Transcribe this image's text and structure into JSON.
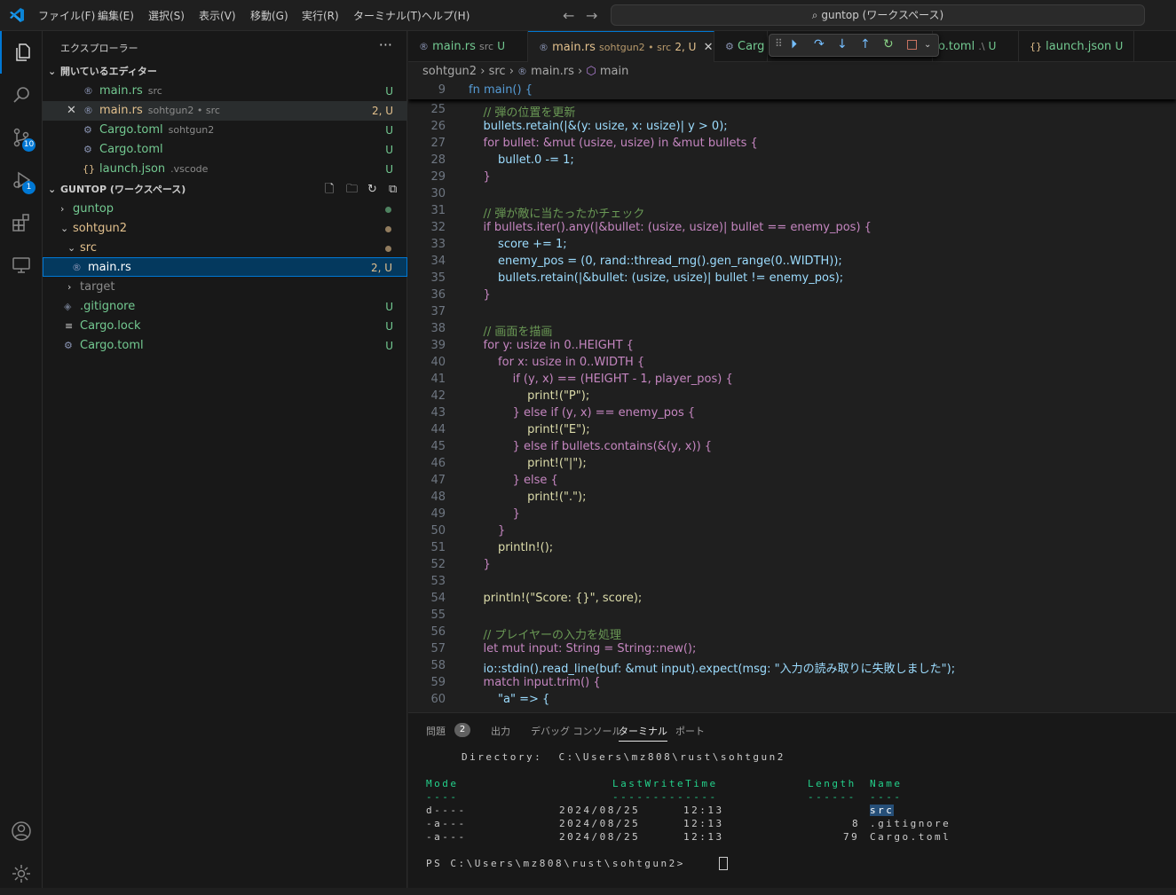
{
  "title_bar": {
    "menus": [
      "ファイル(F)",
      "編集(E)",
      "選択(S)",
      "表示(V)",
      "移動(G)",
      "実行(R)",
      "ターミナル(T)",
      "ヘルプ(H)"
    ],
    "command_center": "guntop (ワークスペース)"
  },
  "activity_bar": {
    "source_control_badge": "10",
    "debug_badge": "1"
  },
  "explorer": {
    "title": "エクスプローラー",
    "open_editors_title": "開いているエディター",
    "open_editors": [
      {
        "name": "main.rs",
        "desc": "src",
        "status": "U"
      },
      {
        "name": "main.rs",
        "desc": "sohtgun2 • src",
        "status": "2, U"
      },
      {
        "name": "Cargo.toml",
        "desc": "sohtgun2",
        "status": "U"
      },
      {
        "name": "Cargo.toml",
        "desc": "",
        "status": "U"
      },
      {
        "name": "launch.json",
        "desc": ".vscode",
        "status": "U"
      }
    ],
    "workspace_title": "GUNTOP (ワークスペース)",
    "tree": [
      {
        "name": "guntop"
      },
      {
        "name": "sohtgun2"
      },
      {
        "name": "src"
      },
      {
        "name": "main.rs",
        "status": "2, U"
      },
      {
        "name": "target"
      },
      {
        "name": ".gitignore",
        "status": "U"
      },
      {
        "name": "Cargo.lock",
        "status": "U"
      },
      {
        "name": "Cargo.toml",
        "status": "U"
      }
    ]
  },
  "tabs": [
    {
      "name": "main.rs",
      "sub": "src",
      "status": "U"
    },
    {
      "name": "main.rs",
      "sub": "sohtgun2 • src",
      "status": "2, U"
    },
    {
      "name": "Carg",
      "sub": "",
      "status": ""
    },
    {
      "name": "o.toml",
      "sub": ".\\",
      "status": "U"
    },
    {
      "name": "launch.json",
      "sub": "",
      "status": "U"
    }
  ],
  "breadcrumb": [
    "sohtgun2",
    "src",
    "main.rs",
    "main"
  ],
  "sticky": {
    "line": "9",
    "code": "fn main() {"
  },
  "code_lines": [
    {
      "n": "25",
      "t": "    // 弾の位置を更新"
    },
    {
      "n": "26",
      "t": "    bullets.retain(|&(y: usize, x: usize)| y > 0);"
    },
    {
      "n": "27",
      "t": "    for bullet: &mut (usize, usize) in &mut bullets {"
    },
    {
      "n": "28",
      "t": "        bullet.0 -= 1;"
    },
    {
      "n": "29",
      "t": "    }"
    },
    {
      "n": "30",
      "t": ""
    },
    {
      "n": "31",
      "t": "    // 弾が敵に当たったかチェック"
    },
    {
      "n": "32",
      "t": "    if bullets.iter().any(|&bullet: (usize, usize)| bullet == enemy_pos) {"
    },
    {
      "n": "33",
      "t": "        score += 1;"
    },
    {
      "n": "34",
      "t": "        enemy_pos = (0, rand::thread_rng().gen_range(0..WIDTH));"
    },
    {
      "n": "35",
      "t": "        bullets.retain(|&bullet: (usize, usize)| bullet != enemy_pos);"
    },
    {
      "n": "36",
      "t": "    }"
    },
    {
      "n": "37",
      "t": ""
    },
    {
      "n": "38",
      "t": "    // 画面を描画"
    },
    {
      "n": "39",
      "t": "    for y: usize in 0..HEIGHT {"
    },
    {
      "n": "40",
      "t": "        for x: usize in 0..WIDTH {"
    },
    {
      "n": "41",
      "t": "            if (y, x) == (HEIGHT - 1, player_pos) {"
    },
    {
      "n": "42",
      "t": "                print!(\"P\");"
    },
    {
      "n": "43",
      "t": "            } else if (y, x) == enemy_pos {"
    },
    {
      "n": "44",
      "t": "                print!(\"E\");"
    },
    {
      "n": "45",
      "t": "            } else if bullets.contains(&(y, x)) {"
    },
    {
      "n": "46",
      "t": "                print!(\"|\");"
    },
    {
      "n": "47",
      "t": "            } else {"
    },
    {
      "n": "48",
      "t": "                print!(\".\");"
    },
    {
      "n": "49",
      "t": "            }"
    },
    {
      "n": "50",
      "t": "        }"
    },
    {
      "n": "51",
      "t": "        println!();"
    },
    {
      "n": "52",
      "t": "    }"
    },
    {
      "n": "53",
      "t": ""
    },
    {
      "n": "54",
      "t": "    println!(\"Score: {}\", score);"
    },
    {
      "n": "55",
      "t": ""
    },
    {
      "n": "56",
      "t": "    // プレイヤーの入力を処理"
    },
    {
      "n": "57",
      "t": "    let mut input: String = String::new();"
    },
    {
      "n": "58",
      "t": "    io::stdin().read_line(buf: &mut input).expect(msg: \"入力の読み取りに失敗しました\");"
    },
    {
      "n": "59",
      "t": "    match input.trim() {"
    },
    {
      "n": "60",
      "t": "        \"a\" => {"
    }
  ],
  "panel": {
    "tabs": [
      "問題",
      "出力",
      "デバッグ コンソール",
      "ターミナル",
      "ポート"
    ],
    "problems_count": "2",
    "terminal": {
      "directory_line": "Directory:  C:\\Users\\mz808\\rust\\sohtgun2",
      "headers": [
        "Mode",
        "LastWriteTime",
        "Length",
        "Name"
      ],
      "dashes": [
        "----",
        "-------------",
        "------",
        "----"
      ],
      "rows": [
        {
          "mode": "d----",
          "date": "2024/08/25",
          "time": "12:13",
          "length": "",
          "name": "src"
        },
        {
          "mode": "-a---",
          "date": "2024/08/25",
          "time": "12:13",
          "length": "8",
          "name": ".gitignore"
        },
        {
          "mode": "-a---",
          "date": "2024/08/25",
          "time": "12:13",
          "length": "79",
          "name": "Cargo.toml"
        }
      ],
      "prompt": "PS C:\\Users\\mz808\\rust\\sohtgun2>"
    }
  }
}
